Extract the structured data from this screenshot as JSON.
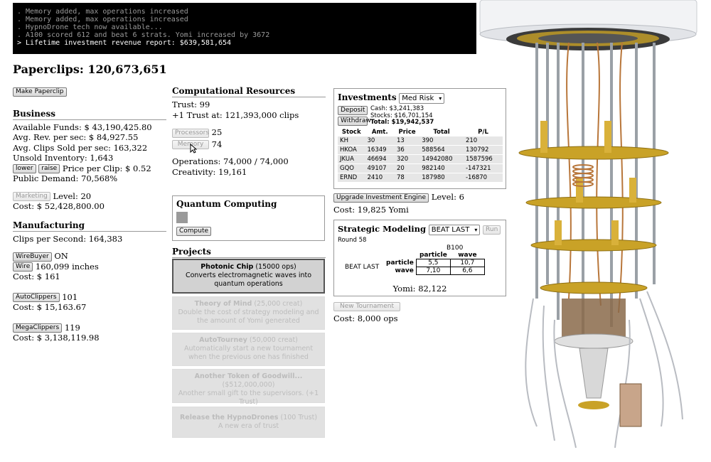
{
  "console": {
    "lines": [
      ". Memory added, max operations increased",
      ". Memory added, max operations increased",
      ". HypnoDrone tech now available...",
      ". A100 scored 612 and beat 6 strats. Yomi increased by 3672",
      "> Lifetime investment revenue report: $639,581,654"
    ]
  },
  "header": {
    "title": "Paperclips: 120,673,651"
  },
  "left": {
    "make_paperclip": "Make Paperclip",
    "business": {
      "title": "Business",
      "available_funds": "Available Funds: $ 43,190,425.80",
      "avg_rev": "Avg. Rev. per sec: $ 84,927.55",
      "avg_clips": "Avg. Clips Sold per sec: 163,322",
      "unsold": "Unsold Inventory: 1,643",
      "lower": "lower",
      "raise": "raise",
      "price": "Price per Clip: $ 0.52",
      "demand": "Public Demand: 70,568%",
      "marketing_btn": "Marketing",
      "marketing_level": "Level: 20",
      "marketing_cost": "Cost: $ 52,428,800.00"
    },
    "manufacturing": {
      "title": "Manufacturing",
      "clips_per_sec": "Clips per Second: 164,383",
      "wirebuyer_btn": "WireBuyer",
      "wirebuyer_state": "ON",
      "wire_btn": "Wire",
      "wire_amount": "160,099 inches",
      "wire_cost": "Cost: $ 161",
      "autoclippers_btn": "AutoClippers",
      "autoclippers_count": "101",
      "autoclippers_cost": "Cost: $ 15,163.67",
      "megaclippers_btn": "MegaClippers",
      "megaclippers_count": "119",
      "megaclippers_cost": "Cost: $ 3,138,119.98"
    }
  },
  "middle": {
    "computational": {
      "title": "Computational Resources",
      "trust": "Trust: 99",
      "next_trust": "+1 Trust at: 121,393,000 clips",
      "processors_btn": "Processors",
      "processors_count": "25",
      "memory_btn": "Memory",
      "memory_count": "74",
      "operations": "Operations: 74,000 / 74,000",
      "creativity": "Creativity: 19,161"
    },
    "quantum": {
      "title": "Quantum Computing",
      "compute_btn": "Compute"
    },
    "projects": {
      "title": "Projects",
      "items": [
        {
          "title": "Photonic Chip",
          "cost": " (15000 ops)",
          "desc": "Converts electromagnetic waves into quantum operations"
        },
        {
          "title": "Theory of Mind",
          "cost": " (25,000 creat)",
          "desc": "Double the cost of strategy modeling and the amount of Yomi generated"
        },
        {
          "title": "AutoTourney",
          "cost": " (50,000 creat)",
          "desc": "Automatically start a new tournament when the previous one has finished"
        },
        {
          "title": "Another Token of Goodwill...",
          "cost": "($512,000,000)",
          "desc": "Another small gift to the supervisors. (+1 Trust)"
        },
        {
          "title": "Release the HypnoDrones",
          "cost": " (100 Trust)",
          "desc": "A new era of trust"
        }
      ]
    }
  },
  "right": {
    "investments": {
      "title": "Investments",
      "risk": "Med Risk",
      "deposit_btn": "Deposit",
      "withdraw_btn": "Withdraw",
      "cash": "Cash: $3,241,383",
      "stocks": "Stocks: $16,701,154",
      "total": "Total: $19,942,537",
      "headers": [
        "Stock",
        "Amt.",
        "Price",
        "Total",
        "P/L"
      ],
      "rows": [
        [
          "KH",
          "30",
          "13",
          "390",
          "210"
        ],
        [
          "HKOA",
          "16349",
          "36",
          "588564",
          "130792"
        ],
        [
          "JKUA",
          "46694",
          "320",
          "14942080",
          "1587596"
        ],
        [
          "GQO",
          "49107",
          "20",
          "982140",
          "-147321"
        ],
        [
          "ERND",
          "2410",
          "78",
          "187980",
          "-16870"
        ]
      ],
      "upgrade_btn": "Upgrade Investment Engine",
      "level": "Level: 6",
      "upgrade_cost": "Cost: 19,825 Yomi"
    },
    "strategic": {
      "title": "Strategic Modeling",
      "strategy": "BEAT LAST",
      "run_btn": "Run",
      "round": "Round 58",
      "opponent": "B100",
      "col_particle": "particle",
      "col_wave": "wave",
      "row_strategy": "BEAT LAST",
      "row_particle": "particle",
      "row_wave": "wave",
      "cells": [
        [
          "5,5",
          "10,7"
        ],
        [
          "7,10",
          "6,6"
        ]
      ],
      "yomi": "Yomi: 82,122",
      "new_tournament_btn": "New Tournament",
      "tournament_cost": "Cost: 8,000 ops"
    }
  },
  "colors": {
    "gold": "#c9a227",
    "copper": "#b8763a",
    "steel": "#9aa0a6"
  }
}
